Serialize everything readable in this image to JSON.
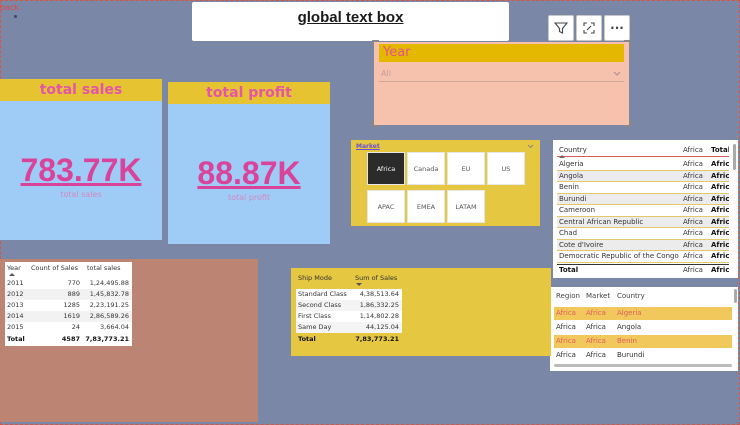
{
  "nav": {
    "back_label": "back"
  },
  "title_box": {
    "text": "global text box"
  },
  "toolbar": {
    "filter_icon": "filter-icon",
    "focus_icon": "focus-mode-icon",
    "more_icon": "more-options-icon",
    "more_label": "···"
  },
  "cards": {
    "sales": {
      "header": "total sales",
      "value": "783.77K",
      "caption": "total sales"
    },
    "profit": {
      "header": "total profit",
      "value": "88.87K",
      "caption": "total profit"
    }
  },
  "year_slicer": {
    "title": "Year",
    "selected": "All"
  },
  "market_slicer": {
    "title": "Market",
    "options": [
      "Africa",
      "Canada",
      "EU",
      "US",
      "APAC",
      "EMEA",
      "LATAM"
    ],
    "selected": "Africa"
  },
  "country_table": {
    "headers": [
      "Country",
      "Africa",
      "Total"
    ],
    "rows": [
      [
        "Algeria",
        "Africa",
        "Africa"
      ],
      [
        "Angola",
        "Africa",
        "Africa"
      ],
      [
        "Benin",
        "Africa",
        "Africa"
      ],
      [
        "Burundi",
        "Africa",
        "Africa"
      ],
      [
        "Cameroon",
        "Africa",
        "Africa"
      ],
      [
        "Central African Republic",
        "Africa",
        "Africa"
      ],
      [
        "Chad",
        "Africa",
        "Africa"
      ],
      [
        "Cote d'Ivoire",
        "Africa",
        "Africa"
      ],
      [
        "Democratic Republic of the Congo",
        "Africa",
        "Africa"
      ]
    ],
    "total": [
      "Total",
      "Africa",
      "Africa"
    ]
  },
  "region_table": {
    "headers": [
      "Region",
      "Market",
      "Country"
    ],
    "rows": [
      [
        "Africa",
        "Africa",
        "Algeria"
      ],
      [
        "Africa",
        "Africa",
        "Angola"
      ],
      [
        "Africa",
        "Africa",
        "Benin"
      ],
      [
        "Africa",
        "Africa",
        "Burundi"
      ]
    ]
  },
  "year_table": {
    "headers": [
      "Year",
      "Count of Sales",
      "total sales"
    ],
    "rows": [
      [
        "2011",
        "770",
        "1,24,495.88"
      ],
      [
        "2012",
        "889",
        "1,45,832.78"
      ],
      [
        "2013",
        "1285",
        "2,23,191.25"
      ],
      [
        "2014",
        "1619",
        "2,86,589.26"
      ],
      [
        "2015",
        "24",
        "3,664.04"
      ]
    ],
    "total": [
      "Total",
      "4587",
      "7,83,773.21"
    ]
  },
  "ship_table": {
    "headers": [
      "Ship Mode",
      "Sum of Sales"
    ],
    "rows": [
      [
        "Standard Class",
        "4,38,513.64"
      ],
      [
        "Second Class",
        "1,86,332.25"
      ],
      [
        "First Class",
        "1,14,802.28"
      ],
      [
        "Same Day",
        "44,125.04"
      ]
    ],
    "total": [
      "Total",
      "7,83,773.21"
    ]
  },
  "colors": {
    "page_bg": "#7b87a6",
    "card_bg": "#9fcbf7",
    "card_header": "#e5c331",
    "kpi_pink": "#d9449a",
    "year_slicer_bg": "#f6c2ad",
    "market_bg": "#e5c742",
    "brown_panel": "#bc8473",
    "highlight_row": "#f0c85c"
  }
}
